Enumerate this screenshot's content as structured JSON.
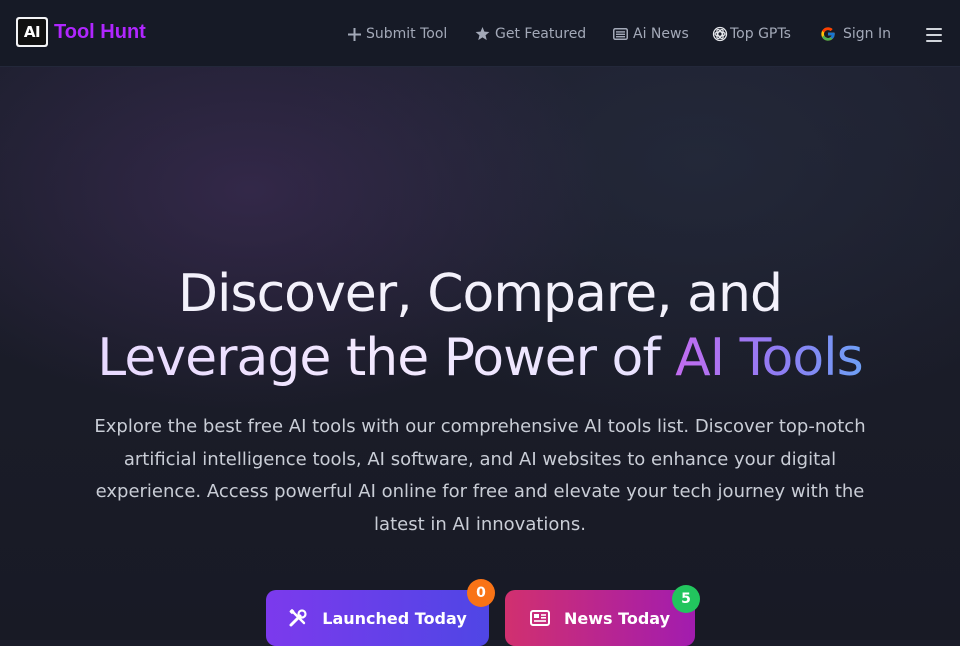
{
  "logo": {
    "badge_text": "AI",
    "name": "Tool Hunt",
    "brand_color": "#b026ff"
  },
  "nav": {
    "submit_tool": "Submit Tool",
    "get_featured": "Get Featured",
    "ai_news": "Ai News",
    "top_gpts": "Top GPTs",
    "sign_in": "Sign In"
  },
  "hero": {
    "title_line1": "Discover, Compare, and",
    "title_line2_part1": "Leverage the Power of ",
    "title_line2_highlight": "AI Tools",
    "description": "Explore the best free AI tools with our comprehensive AI tools list. Discover top-notch artificial intelligence tools, AI software, and AI websites to enhance your digital experience. Access powerful AI online for free and elevate your tech journey with the latest in AI innovations."
  },
  "cta": {
    "launched_today": {
      "label": "Launched Today",
      "count": "0",
      "badge_color": "#f97316"
    },
    "news_today": {
      "label": "News Today",
      "count": "5",
      "badge_color": "#22c55e"
    }
  }
}
